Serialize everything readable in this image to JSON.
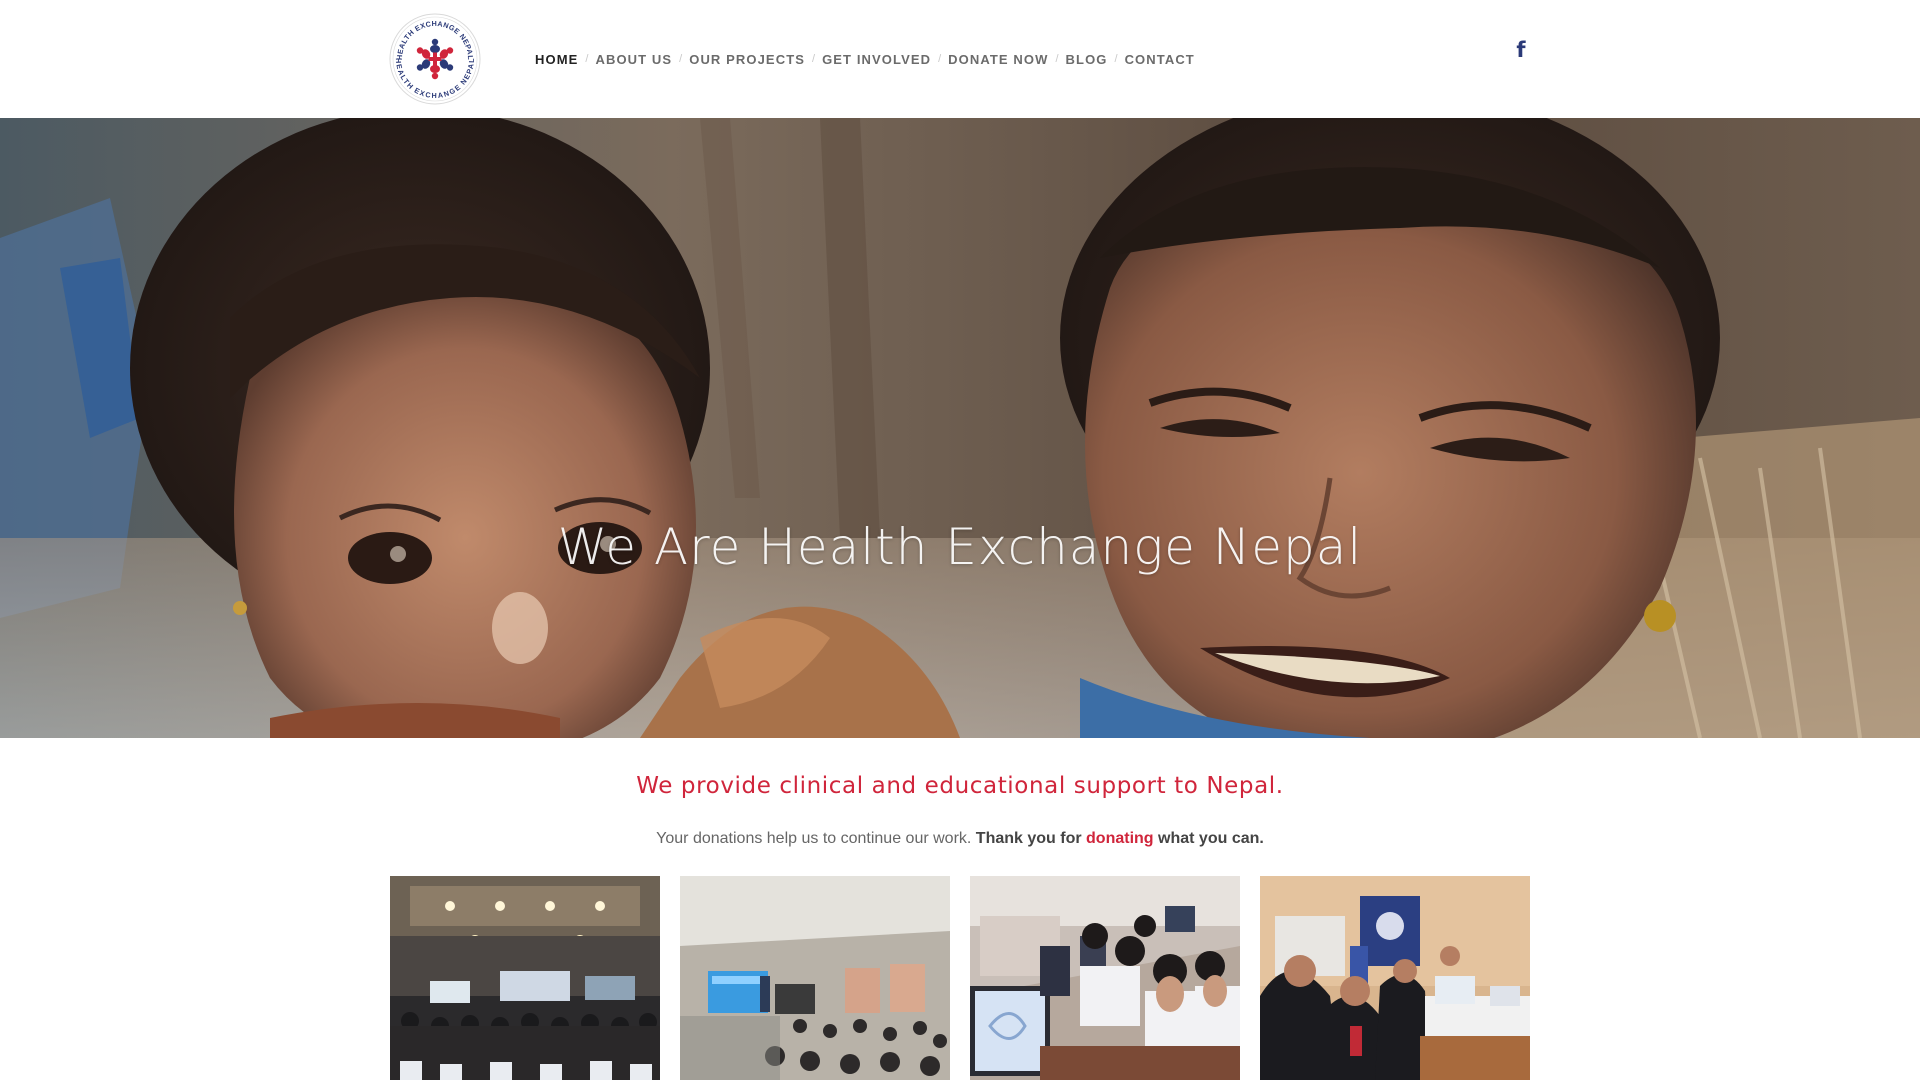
{
  "site": {
    "logo_text": "HEALTH EXCHANGE NEPAL",
    "brand_colors": {
      "red": "#d0253b",
      "navy": "#2b3a78"
    }
  },
  "nav": {
    "items": [
      {
        "label": "HOME",
        "active": true
      },
      {
        "label": "ABOUT US"
      },
      {
        "label": "OUR PROJECTS"
      },
      {
        "label": "GET INVOLVED"
      },
      {
        "label": "DONATE NOW"
      },
      {
        "label": "BLOG"
      },
      {
        "label": "CONTACT"
      }
    ],
    "separator": "/",
    "social_icon": "facebook-icon",
    "social_glyph": "f"
  },
  "hero": {
    "title": "We Are Health Exchange Nepal"
  },
  "intro": {
    "tagline": "We provide clinical and educational support to Nepal.",
    "text_plain": "Your donations help us to continue our work.",
    "thanks_before": "Thank you for",
    "donate_link": "donating",
    "thanks_after": "what you can."
  },
  "gallery": {
    "images": [
      "conference-hall-photo",
      "classroom-presentation-photo",
      "computer-lab-students-photo",
      "equipment-demonstration-photo"
    ]
  }
}
